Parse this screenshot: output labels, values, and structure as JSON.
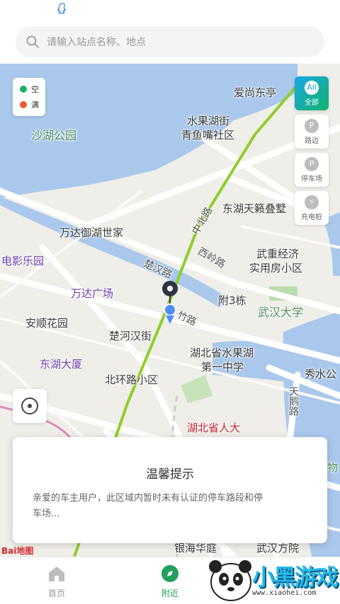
{
  "search": {
    "placeholder": "请输入站点名称、地点"
  },
  "legend": {
    "items": [
      {
        "label": "空",
        "color": "#1bb06a"
      },
      {
        "label": "满",
        "color": "#ee5a34"
      }
    ]
  },
  "filters": [
    {
      "label": "全部",
      "icon_text": "All",
      "active": true
    },
    {
      "label": "路边",
      "icon_text": "P",
      "active": false
    },
    {
      "label": "停车场",
      "icon_text": "P",
      "active": false
    },
    {
      "label": "充电桩",
      "icon_text": "⚡",
      "active": false
    }
  ],
  "map_labels": {
    "aishang": "爱尚东亭",
    "shuiguohu_jie": "水果湖街",
    "qingyuzui": "青鱼嘴社区",
    "shahu_park": "沙湖公园",
    "donghu_tianlai": "东湖天籁叠墅",
    "zhongbei_road": "中北路",
    "wanda_yuhu": "万达御湖世家",
    "xiling_road": "西岭路",
    "wuzhong": "武重经济",
    "wuzhong2": "实用房小区",
    "film_park": "电影乐园",
    "chuhan_road": "楚汉路",
    "wanda_plaza": "万达广场",
    "fu3": "附3栋",
    "wuhan_univ": "武汉大学",
    "zhu_road": "竹路",
    "anshun": "安顺花园",
    "chuhe_hanjie": "楚河汉街",
    "school1": "湖北省水果湖",
    "school2": "第一中学",
    "donghu_dasha": "东湖大厦",
    "xiushui": "秀水公",
    "beihuan": "北环路小区",
    "tianhe_road": "天鹅路",
    "hubei_people": "湖北省人大",
    "yinhai": "银海华庭",
    "wuhan_fang": "武汉方院",
    "wu": "物"
  },
  "notice": {
    "title": "温馨提示",
    "text": "亲爱的车主用户，此区域内暂时未有认证的停车路段和停车场..."
  },
  "baidu": "Bai地图",
  "tabs": [
    {
      "label": "首页",
      "active": false
    },
    {
      "label": "附近",
      "active": true
    }
  ],
  "watermark": {
    "text": "小黑游戏",
    "url": "www.xiaohei.com"
  },
  "colors": {
    "accent": "#20a05a",
    "water": "#a9c8ec",
    "road_green": "#8fce2a"
  }
}
